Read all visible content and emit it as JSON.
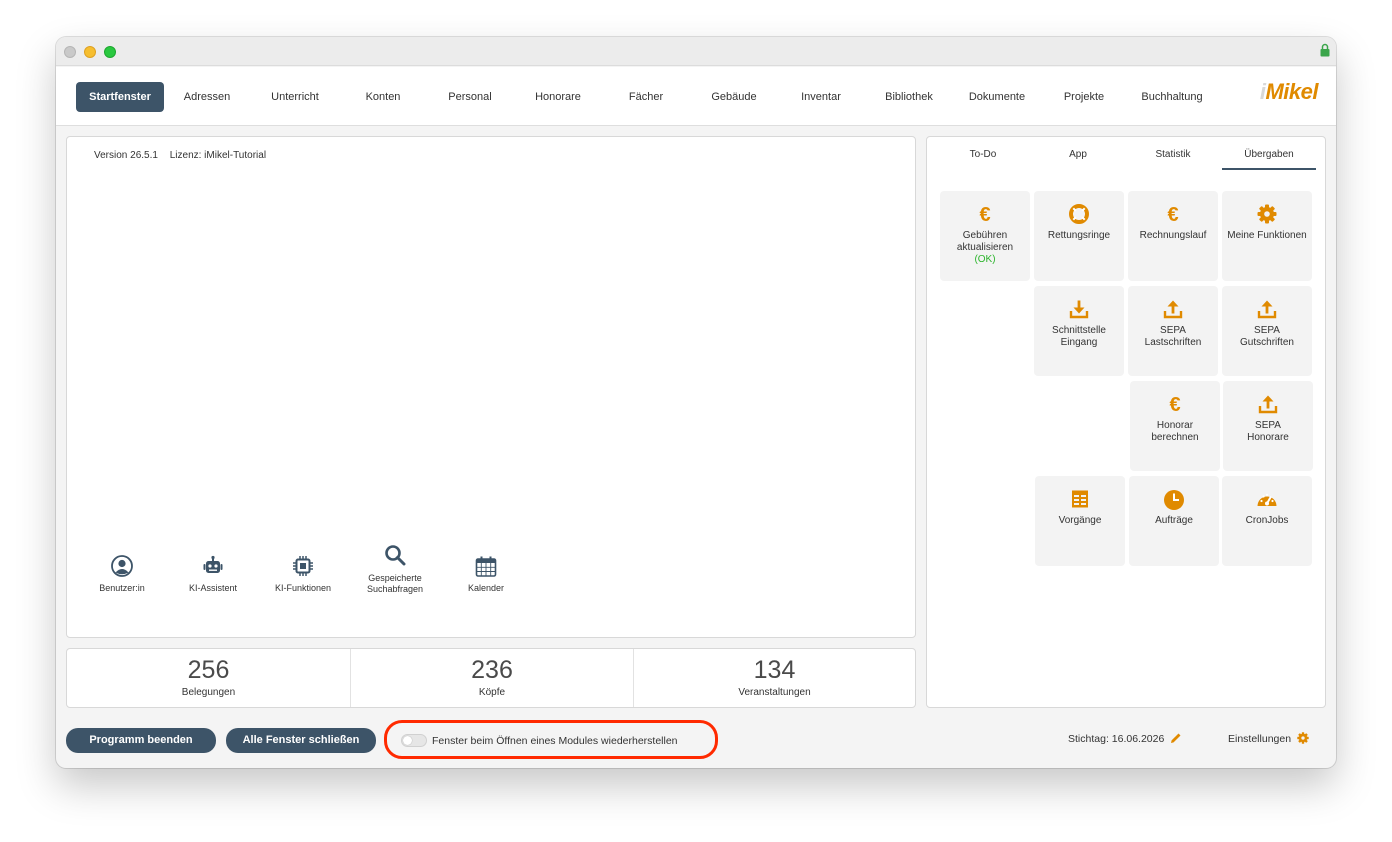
{
  "nav": {
    "items": [
      "Startfenster",
      "Adressen",
      "Unterricht",
      "Konten",
      "Personal",
      "Honorare",
      "Fächer",
      "Gebäude",
      "Inventar",
      "Bibliothek",
      "Dokumente",
      "Projekte",
      "Buchhaltung"
    ],
    "active": "Startfenster",
    "logo_prefix": "i",
    "logo_rest": "Mikel"
  },
  "main": {
    "version": "Version 26.5.1",
    "license": "Lizenz: iMikel-Tutorial",
    "quick": [
      {
        "label": "Benutzer:in",
        "icon": "user-circle-icon"
      },
      {
        "label": "KI-Assistent",
        "icon": "robot-icon"
      },
      {
        "label": "KI-Funktionen",
        "icon": "chip-icon"
      },
      {
        "label_line1": "Gespeicherte",
        "label_line2": "Suchabfragen",
        "icon": "search-icon"
      },
      {
        "label": "Kalender",
        "icon": "calendar-icon"
      }
    ]
  },
  "stats": [
    {
      "value": "256",
      "label": "Belegungen"
    },
    {
      "value": "236",
      "label": "Köpfe"
    },
    {
      "value": "134",
      "label": "Veranstaltungen"
    }
  ],
  "right": {
    "tabs": [
      "To-Do",
      "App",
      "Statistik",
      "Übergaben"
    ],
    "active_tab": "Übergaben",
    "tiles": {
      "gebuehren": {
        "l1": "Gebühren",
        "l2": "aktualisieren",
        "status": "(OK)"
      },
      "rettungsringe": {
        "l1": "Rettungsringe"
      },
      "rechnungslauf": {
        "l1": "Rechnungslauf"
      },
      "meine_funktionen": {
        "l1": "Meine Funktionen"
      },
      "schnittstelle": {
        "l1": "Schnittstelle",
        "l2": "Eingang"
      },
      "sepa_last": {
        "l1": "SEPA",
        "l2": "Lastschriften"
      },
      "sepa_gut": {
        "l1": "SEPA",
        "l2": "Gutschriften"
      },
      "honorar": {
        "l1": "Honorar",
        "l2": "berechnen"
      },
      "sepa_hon": {
        "l1": "SEPA",
        "l2": "Honorare"
      },
      "vorgaenge": {
        "l1": "Vorgänge"
      },
      "auftraege": {
        "l1": "Aufträge"
      },
      "cronjobs": {
        "l1": "CronJobs"
      }
    }
  },
  "footer": {
    "quit": "Programm beenden",
    "close_all": "Alle Fenster schließen",
    "restore_toggle": "Fenster beim Öffnen eines Modules wiederherstellen",
    "stichtag": "Stichtag: 16.06.2026",
    "settings": "Einstellungen"
  },
  "colors": {
    "accent": "#3d5468",
    "orange": "#e08a00",
    "ok": "#2db52d",
    "highlight": "#ff2a00"
  }
}
